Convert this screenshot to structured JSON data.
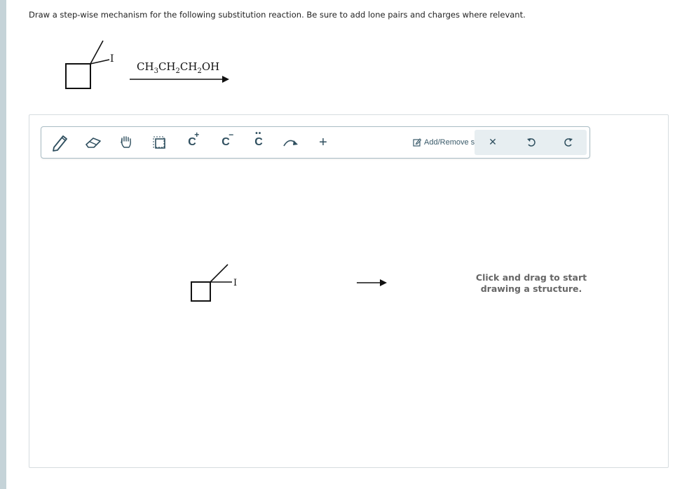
{
  "question": {
    "instructions": "Draw a step-wise mechanism for the following substitution reaction. Be sure to add lone pairs and charges where relevant.",
    "reactant_label": "I",
    "reagent": {
      "parts": [
        "CH",
        "3",
        "CH",
        "2",
        "CH",
        "2",
        "OH"
      ]
    }
  },
  "toolbar": {
    "tools": [
      {
        "name": "pencil-icon"
      },
      {
        "name": "eraser-icon"
      },
      {
        "name": "hand-icon"
      },
      {
        "name": "selection-icon"
      },
      {
        "name": "carbocation-icon",
        "symbol": "C",
        "charge": "+"
      },
      {
        "name": "carbanion-icon",
        "symbol": "C",
        "charge": "−"
      },
      {
        "name": "lone-pair-icon",
        "symbol": "C"
      },
      {
        "name": "curved-arrow-icon"
      },
      {
        "name": "plus-icon",
        "symbol": "+"
      }
    ],
    "add_step_label": "Add/Remove step",
    "actions": [
      {
        "name": "clear-icon",
        "symbol": "✕"
      },
      {
        "name": "undo-icon"
      },
      {
        "name": "redo-icon"
      }
    ]
  },
  "canvas": {
    "molecule_label": "I",
    "hint": "Click and drag to start drawing a structure."
  },
  "colors": {
    "rail": "#c5d3d8",
    "toolbar_border": "#a9bcc4",
    "icon": "#2f4f5f",
    "action_bg": "#e7eef1",
    "hint_text": "#666666"
  }
}
